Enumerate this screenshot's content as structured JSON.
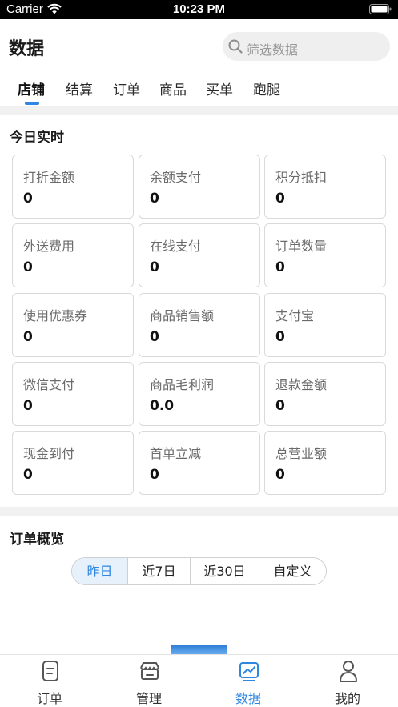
{
  "status_bar": {
    "carrier": "Carrier",
    "time": "10:23 PM"
  },
  "header": {
    "title": "数据",
    "search_placeholder": "筛选数据"
  },
  "tabs": [
    {
      "label": "店铺",
      "active": true
    },
    {
      "label": "结算",
      "active": false
    },
    {
      "label": "订单",
      "active": false
    },
    {
      "label": "商品",
      "active": false
    },
    {
      "label": "买单",
      "active": false
    },
    {
      "label": "跑腿",
      "active": false
    }
  ],
  "today": {
    "title": "今日实时",
    "stats": [
      {
        "label": "打折金额",
        "value": "0"
      },
      {
        "label": "余额支付",
        "value": "0"
      },
      {
        "label": "积分抵扣",
        "value": "0"
      },
      {
        "label": "外送费用",
        "value": "0"
      },
      {
        "label": "在线支付",
        "value": "0"
      },
      {
        "label": "订单数量",
        "value": "0"
      },
      {
        "label": "使用优惠券",
        "value": "0"
      },
      {
        "label": "商品销售额",
        "value": "0"
      },
      {
        "label": "支付宝",
        "value": "0"
      },
      {
        "label": "微信支付",
        "value": "0"
      },
      {
        "label": "商品毛利润",
        "value": "0.0"
      },
      {
        "label": "退款金额",
        "value": "0"
      },
      {
        "label": "现金到付",
        "value": "0"
      },
      {
        "label": "首单立减",
        "value": "0"
      },
      {
        "label": "总营业额",
        "value": "0"
      }
    ]
  },
  "overview": {
    "title": "订单概览",
    "ranges": [
      {
        "label": "昨日",
        "selected": true
      },
      {
        "label": "近7日",
        "selected": false
      },
      {
        "label": "近30日",
        "selected": false
      },
      {
        "label": "自定义",
        "selected": false
      }
    ]
  },
  "tab_bar": [
    {
      "label": "订单",
      "icon": "order-icon",
      "active": false
    },
    {
      "label": "管理",
      "icon": "store-icon",
      "active": false
    },
    {
      "label": "数据",
      "icon": "chart-icon",
      "active": true
    },
    {
      "label": "我的",
      "icon": "person-icon",
      "active": false
    }
  ],
  "colors": {
    "accent": "#2f86e0",
    "card_border": "#d9d9d9",
    "band": "#f1f1f1"
  }
}
